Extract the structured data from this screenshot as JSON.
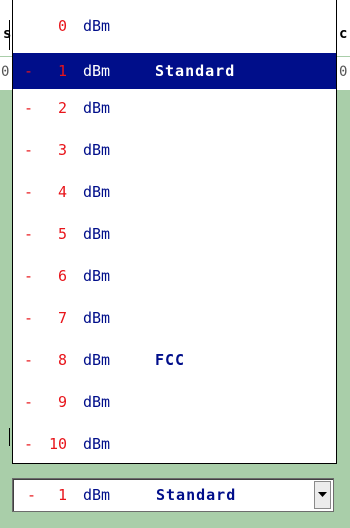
{
  "background": {
    "left_edge_text": "s",
    "right_edge_text": "c",
    "left_edge_digit": "0",
    "right_edge_digit": "0",
    "color": "#a9cea9"
  },
  "dropdown": {
    "selected_index": 1,
    "options": [
      {
        "sign": "",
        "value": "0",
        "unit": "dBm",
        "mode": ""
      },
      {
        "sign": "-",
        "value": "1",
        "unit": "dBm",
        "mode": "Standard"
      },
      {
        "sign": "-",
        "value": "2",
        "unit": "dBm",
        "mode": ""
      },
      {
        "sign": "-",
        "value": "3",
        "unit": "dBm",
        "mode": ""
      },
      {
        "sign": "-",
        "value": "4",
        "unit": "dBm",
        "mode": ""
      },
      {
        "sign": "-",
        "value": "5",
        "unit": "dBm",
        "mode": ""
      },
      {
        "sign": "-",
        "value": "6",
        "unit": "dBm",
        "mode": ""
      },
      {
        "sign": "-",
        "value": "7",
        "unit": "dBm",
        "mode": ""
      },
      {
        "sign": "-",
        "value": "8",
        "unit": "dBm",
        "mode": "FCC"
      },
      {
        "sign": "-",
        "value": "9",
        "unit": "dBm",
        "mode": ""
      },
      {
        "sign": "-",
        "value": "10",
        "unit": "dBm",
        "mode": ""
      }
    ]
  },
  "combo": {
    "sign": "-",
    "value": "1",
    "unit": "dBm",
    "mode": "Standard",
    "button_icon": "chevron-down-icon"
  },
  "colors": {
    "number": "#e8141a",
    "text": "#000e8a",
    "selection": "#000e8a"
  }
}
